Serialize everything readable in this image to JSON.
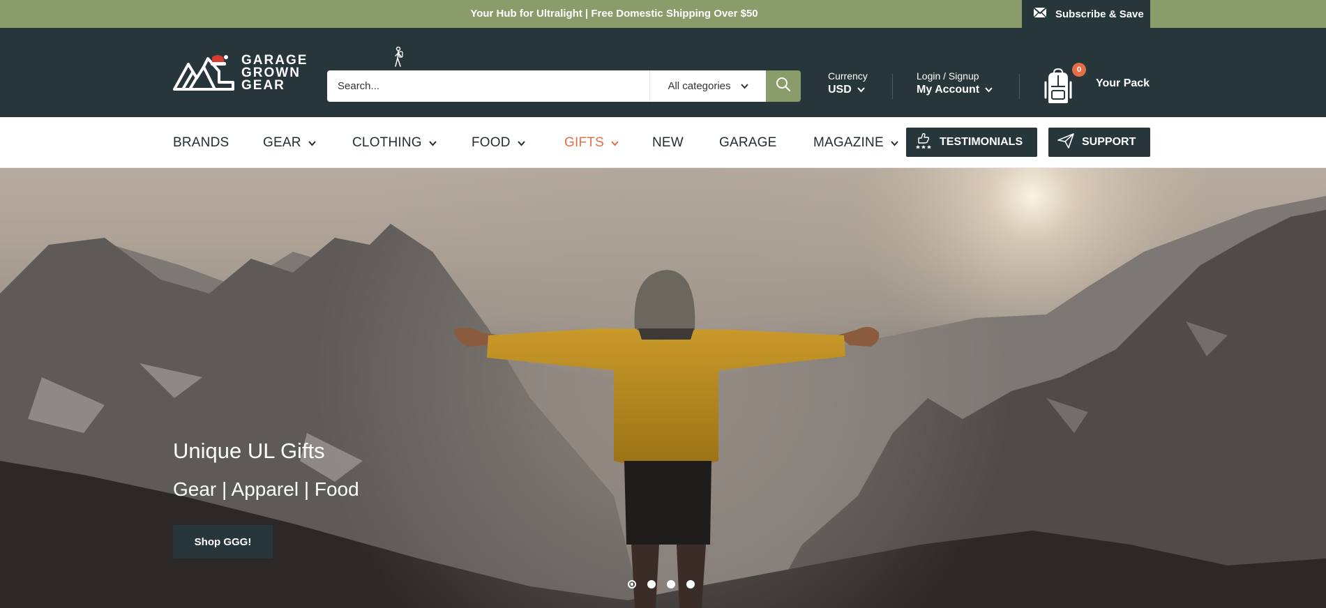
{
  "topbar": {
    "announcement": "Your Hub for Ultralight | Free Domestic Shipping Over $50",
    "subscribe_label": "Subscribe & Save",
    "subscribe_icon": "mail-icon"
  },
  "header": {
    "logo_text": [
      "GARAGE",
      "GROWN",
      "GEAR"
    ],
    "search": {
      "placeholder": "Search...",
      "value": "",
      "category": "All categories"
    },
    "currency": {
      "label": "Currency",
      "value": "USD"
    },
    "account": {
      "label": "Login / Signup",
      "value": "My Account"
    },
    "cart": {
      "count": "0",
      "label": "Your Pack",
      "icon": "backpack-icon"
    }
  },
  "nav": {
    "items": [
      {
        "label": "BRANDS",
        "has_dropdown": false
      },
      {
        "label": "GEAR",
        "has_dropdown": true
      },
      {
        "label": "CLOTHING",
        "has_dropdown": true
      },
      {
        "label": "FOOD",
        "has_dropdown": true
      },
      {
        "label": "GIFTS",
        "has_dropdown": true,
        "active": true
      },
      {
        "label": "NEW",
        "has_dropdown": false
      },
      {
        "label": "GARAGE",
        "has_dropdown": false
      },
      {
        "label": "MAGAZINE",
        "has_dropdown": true
      }
    ],
    "testimonials_label": "TESTIMONIALS",
    "support_label": "SUPPORT"
  },
  "hero": {
    "title": "Unique UL Gifts",
    "subtitle": "Gear | Apparel | Food",
    "button_label": "Shop GGG!",
    "slides_total": 4,
    "active_slide": 1
  },
  "colors": {
    "brand_green": "#8a9c6a",
    "brand_dark": "#26363b",
    "accent_orange": "#e46e46"
  }
}
